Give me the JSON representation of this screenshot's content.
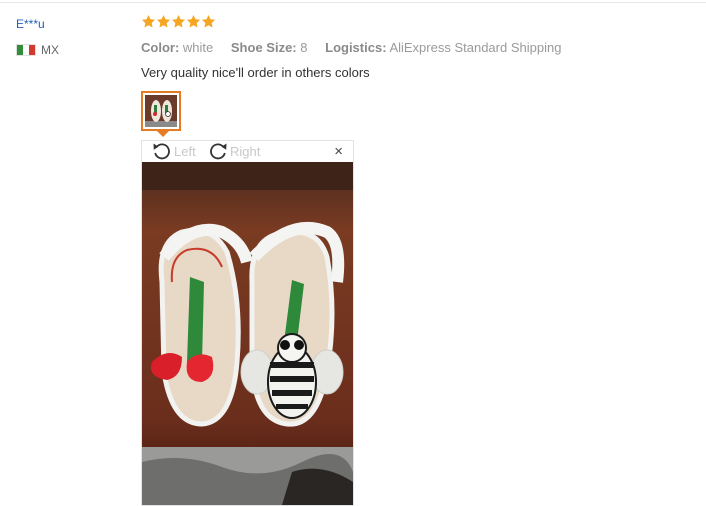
{
  "review": {
    "user": "E***u",
    "country": "MX",
    "rating": 5,
    "meta": [
      {
        "key": "Color:",
        "value": "white"
      },
      {
        "key": "Shoe Size:",
        "value": "8"
      },
      {
        "key": "Logistics:",
        "value": "AliExpress Standard Shipping"
      }
    ],
    "comment": "Very quality nice'll order in others colors"
  },
  "viewer": {
    "rotate_left": "Left",
    "rotate_right": "Right",
    "close": "×"
  },
  "colors": {
    "star": "#f6a623",
    "username": "#2460b8",
    "thumb_border": "#e57b22"
  },
  "icons": [
    "star-icon",
    "mexico-flag-icon",
    "rotate-left-icon",
    "rotate-right-icon",
    "close-icon"
  ]
}
